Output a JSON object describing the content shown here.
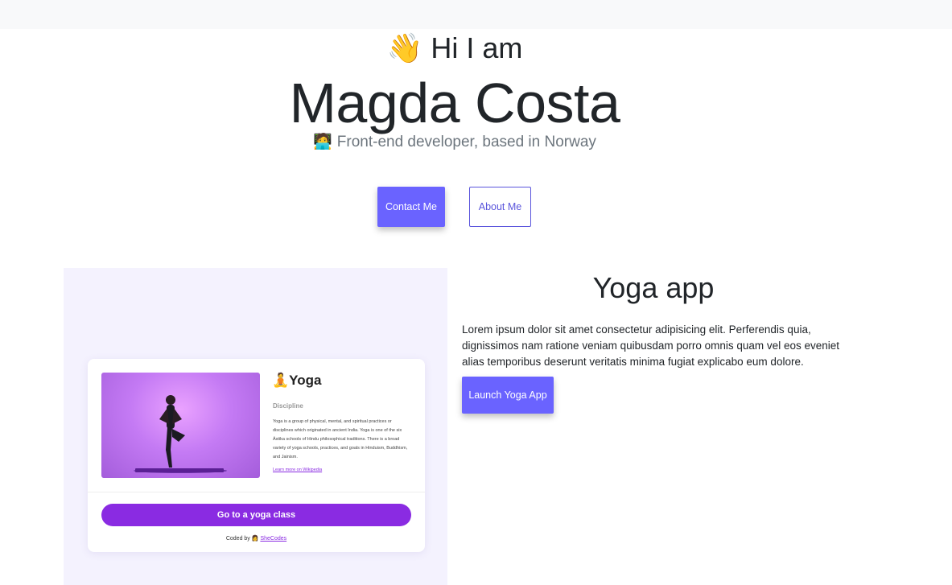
{
  "hero": {
    "greeting_icon": "waving-hand-icon",
    "greeting_emoji": "👋",
    "greeting": "Hi I am",
    "name": "Magda Costa",
    "tagline_icon": "laptop-icon",
    "tagline_emoji": "🧑‍💻",
    "tagline": "Front-end developer, based in Norway",
    "contact_button": "Contact Me",
    "about_button": "About Me"
  },
  "project": {
    "title": "Yoga app",
    "description": "Lorem ipsum dolor sit amet consectetur adipisicing elit. Perferendis quia, dignissimos nam ratione veniam quibusdam porro omnis quam vel eos eveniet alias temporibus deserunt veritatis minima fugiat explicabo eum dolore.",
    "launch_button": "Launch Yoga App",
    "preview": {
      "title_emoji": "🧘",
      "title": "Yoga",
      "label": "Discipline",
      "text": "Yoga is a group of physical, mental, and spiritual practices or disciplines which originated in ancient India. Yoga is one of the six Āstika schools of Hindu philosophical traditions. There is a broad variety of yoga schools, practices, and goals in Hinduism, Buddhism, and Jainism.",
      "link": "Learn more on Wikipedia",
      "button": "Go to a yoga class",
      "coded_by": "Coded by",
      "coded_by_emoji": "👩",
      "coded_by_link": "SheCodes"
    }
  },
  "colors": {
    "accent": "#6a63ff",
    "preview_accent": "#8a2be2",
    "preview_bg": "#f4f2fe"
  }
}
